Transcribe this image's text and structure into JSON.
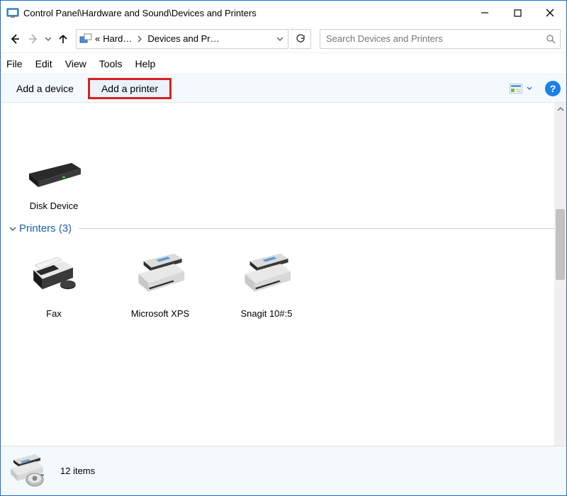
{
  "window": {
    "title": "Control Panel\\Hardware and Sound\\Devices and Printers"
  },
  "breadcrumb": {
    "prefix": "«",
    "first": "Hard…",
    "second": "Devices and Pr…"
  },
  "search": {
    "placeholder": "Search Devices and Printers"
  },
  "menu": {
    "file": "File",
    "edit": "Edit",
    "view": "View",
    "tools": "Tools",
    "help": "Help"
  },
  "toolbar": {
    "add_device": "Add a device",
    "add_printer": "Add a printer"
  },
  "devices": {
    "disk_label": "Disk Device"
  },
  "printers_section": {
    "title": "Printers (3)",
    "items": [
      {
        "label": "Fax"
      },
      {
        "label": "Microsoft XPS"
      },
      {
        "label": "Snagit 10#:5"
      }
    ]
  },
  "status": {
    "count_text": "12 items"
  }
}
